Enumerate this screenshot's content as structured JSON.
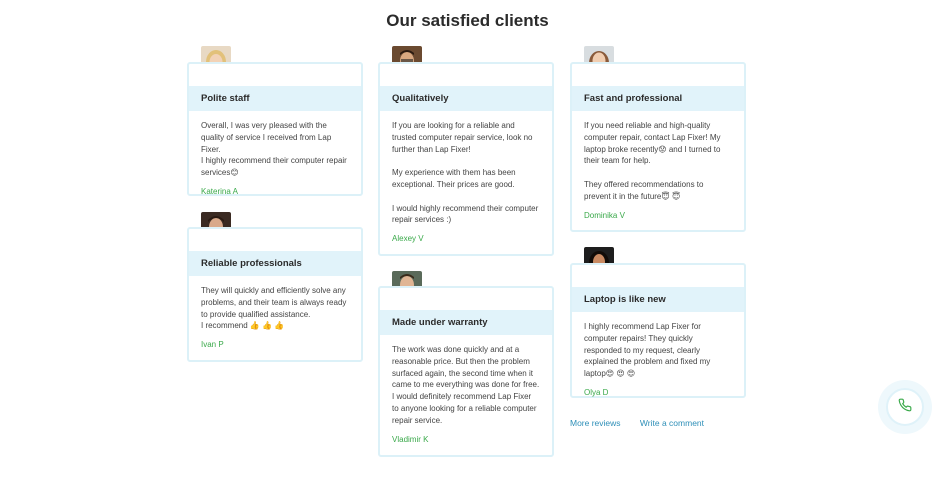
{
  "title": "Our satisfied clients",
  "reviews": [
    {
      "heading": "Polite staff",
      "text": "Overall, I was very pleased with the quality of service I received from Lap Fixer.\nI highly recommend their computer repair services😊",
      "author": "Katerina A"
    },
    {
      "heading": "Reliable professionals",
      "text": "They will quickly and efficiently solve any problems, and their team is always ready to provide qualified assistance.\nI recommend 👍 👍 👍",
      "author": "Ivan P"
    },
    {
      "heading": "Qualitatively",
      "text": "If you are looking for a reliable and trusted computer repair service, look no further than Lap Fixer!\n\nMy experience with them has been exceptional. Their prices are good.\n\nI would highly recommend their computer repair services :)",
      "author": "Alexey V"
    },
    {
      "heading": "Made under warranty",
      "text": "The work was done quickly and at a reasonable price. But then the problem surfaced again, the second time when it came to me everything was done for free.\nI would definitely recommend Lap Fixer to anyone looking for a reliable computer repair service.",
      "author": "Vladimir K"
    },
    {
      "heading": "Fast and professional",
      "text": "If you need reliable and high-quality computer repair, contact Lap Fixer! My laptop broke recently😟 and I turned to their team for help.\n\nThey offered recommendations to prevent it in the future😇 😇",
      "author": "Dominika V"
    },
    {
      "heading": "Laptop is like new",
      "text": "I highly recommend Lap Fixer for computer repairs! They quickly responded to my request, clearly explained the problem and fixed my laptop😍 😍 😍",
      "author": "Olya D"
    }
  ],
  "links": {
    "more": "More reviews",
    "write": "Write a comment"
  },
  "icons": {
    "call": "phone-icon"
  },
  "colors": {
    "header_bg": "#e1f3fa",
    "border": "#dcf1f8",
    "author": "#3aa94a",
    "link": "#2e8fb8"
  }
}
